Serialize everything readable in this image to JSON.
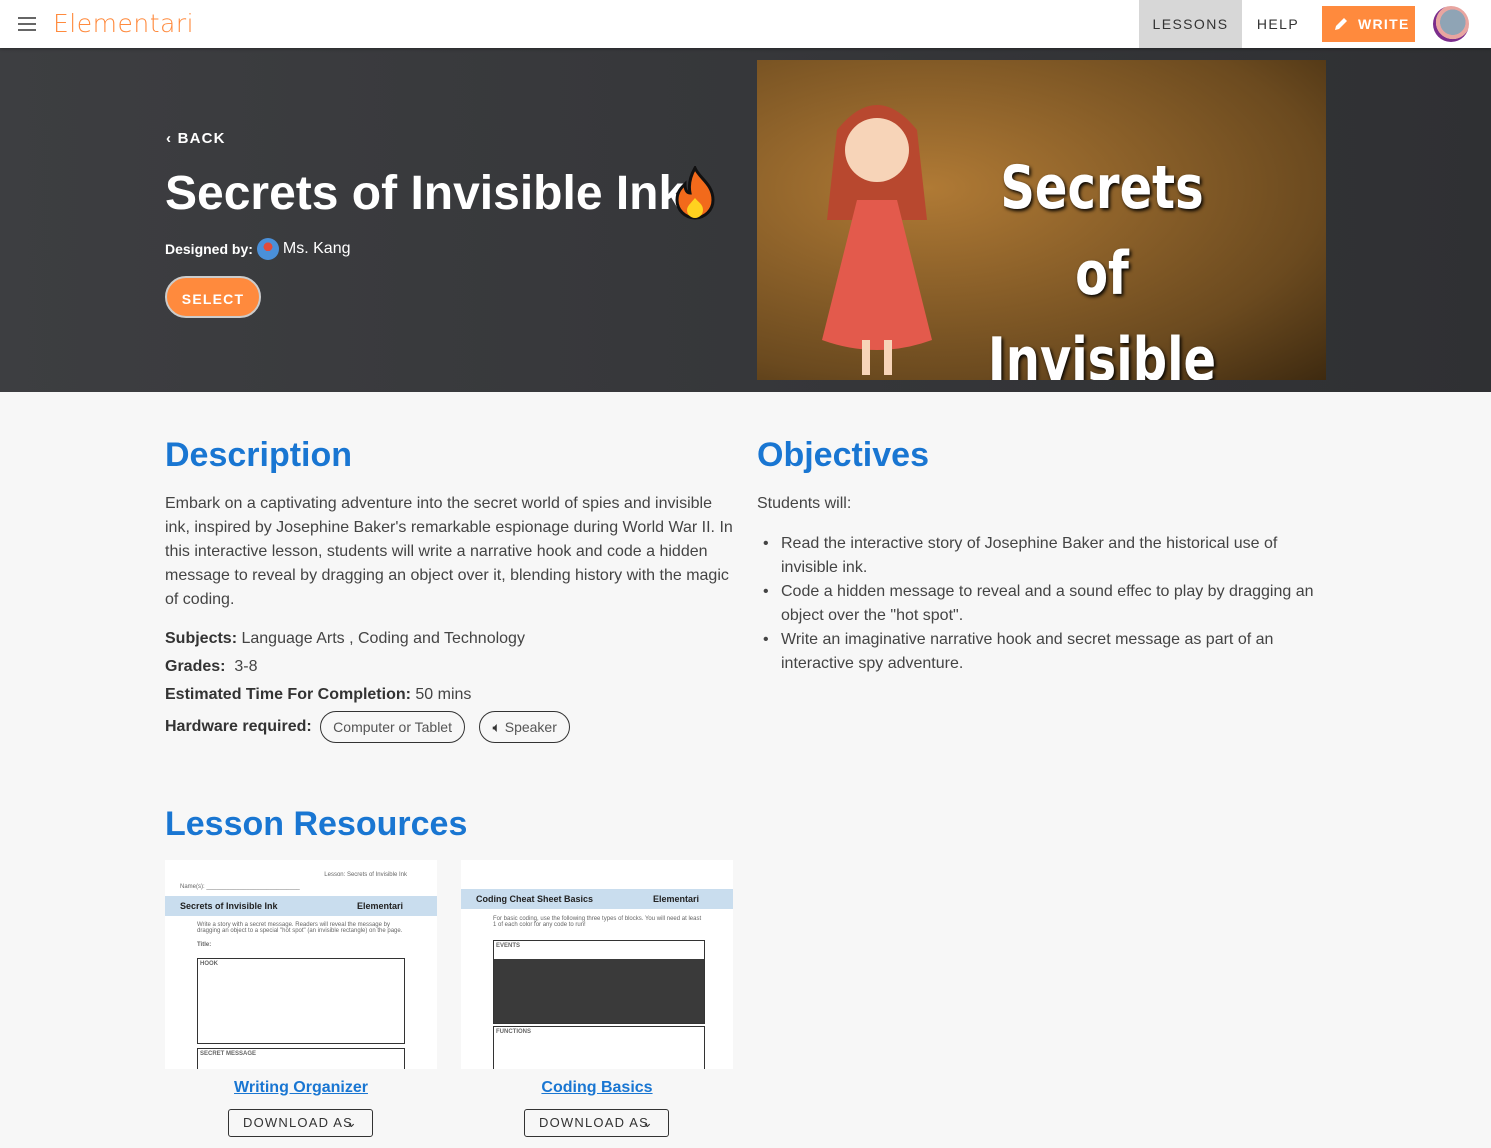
{
  "header": {
    "logo": "Elementari",
    "nav": {
      "lessons": "LESSONS",
      "help": "HELP",
      "write": "WRITE"
    },
    "accent": "#ff8a3d"
  },
  "hero": {
    "back": "BACK",
    "title": "Secrets of Invisible Ink",
    "designed_by_label": "Designed by:",
    "author": "Ms. Kang",
    "select": "SELECT",
    "image_title": "Secrets of Invisible Ink"
  },
  "description": {
    "heading": "Description",
    "text": "Embark on a captivating adventure into the secret world of spies and invisible ink, inspired by Josephine Baker's remarkable espionage during World War II. In this interactive lesson, students will write a narrative hook and code a hidden message to reveal by dragging an object over it, blending history with the magic of coding.",
    "subjects_label": "Subjects:",
    "subjects": "Language Arts , Coding and Technology",
    "grades_label": "Grades:",
    "grades": "3-8",
    "time_label": "Estimated Time For Completion:",
    "time": "50 mins",
    "hardware_label": "Hardware required:",
    "hardware": [
      "Computer or Tablet",
      "Speaker"
    ]
  },
  "objectives": {
    "heading": "Objectives",
    "intro": "Students will:",
    "items": [
      "Read the interactive story of Josephine Baker and the historical use of invisible ink.",
      "Code a hidden message to reveal and a sound effec to play by dragging an object over the \"hot spot\".",
      "Write an imaginative narrative hook and secret message as part of an interactive spy adventure."
    ]
  },
  "resources": {
    "heading": "Lesson Resources",
    "items": [
      {
        "title": "Writing Organizer",
        "download": "DOWNLOAD AS",
        "thumb_title": "Secrets of Invisible Ink",
        "thumb_brand": "Elementari",
        "thumb_top": "Lesson: Secrets of Invisible Ink",
        "thumb_name": "Name(s): ____________________________",
        "thumb_intro": "Write a story with a secret message. Readers will reveal the message by dragging an object to a special \"hot spot\" (an invisible rectangle) on the page.",
        "thumb_sections": [
          "Title:",
          "HOOK",
          "SECRET MESSAGE"
        ]
      },
      {
        "title": "Coding Basics",
        "download": "DOWNLOAD AS",
        "thumb_title": "Coding Cheat Sheet Basics",
        "thumb_brand": "Elementari",
        "thumb_intro": "For basic coding, use the following three types of blocks. You will need at least 1 of each color for any code to run!",
        "thumb_sections": [
          "EVENTS",
          "FUNCTIONS"
        ]
      }
    ]
  }
}
